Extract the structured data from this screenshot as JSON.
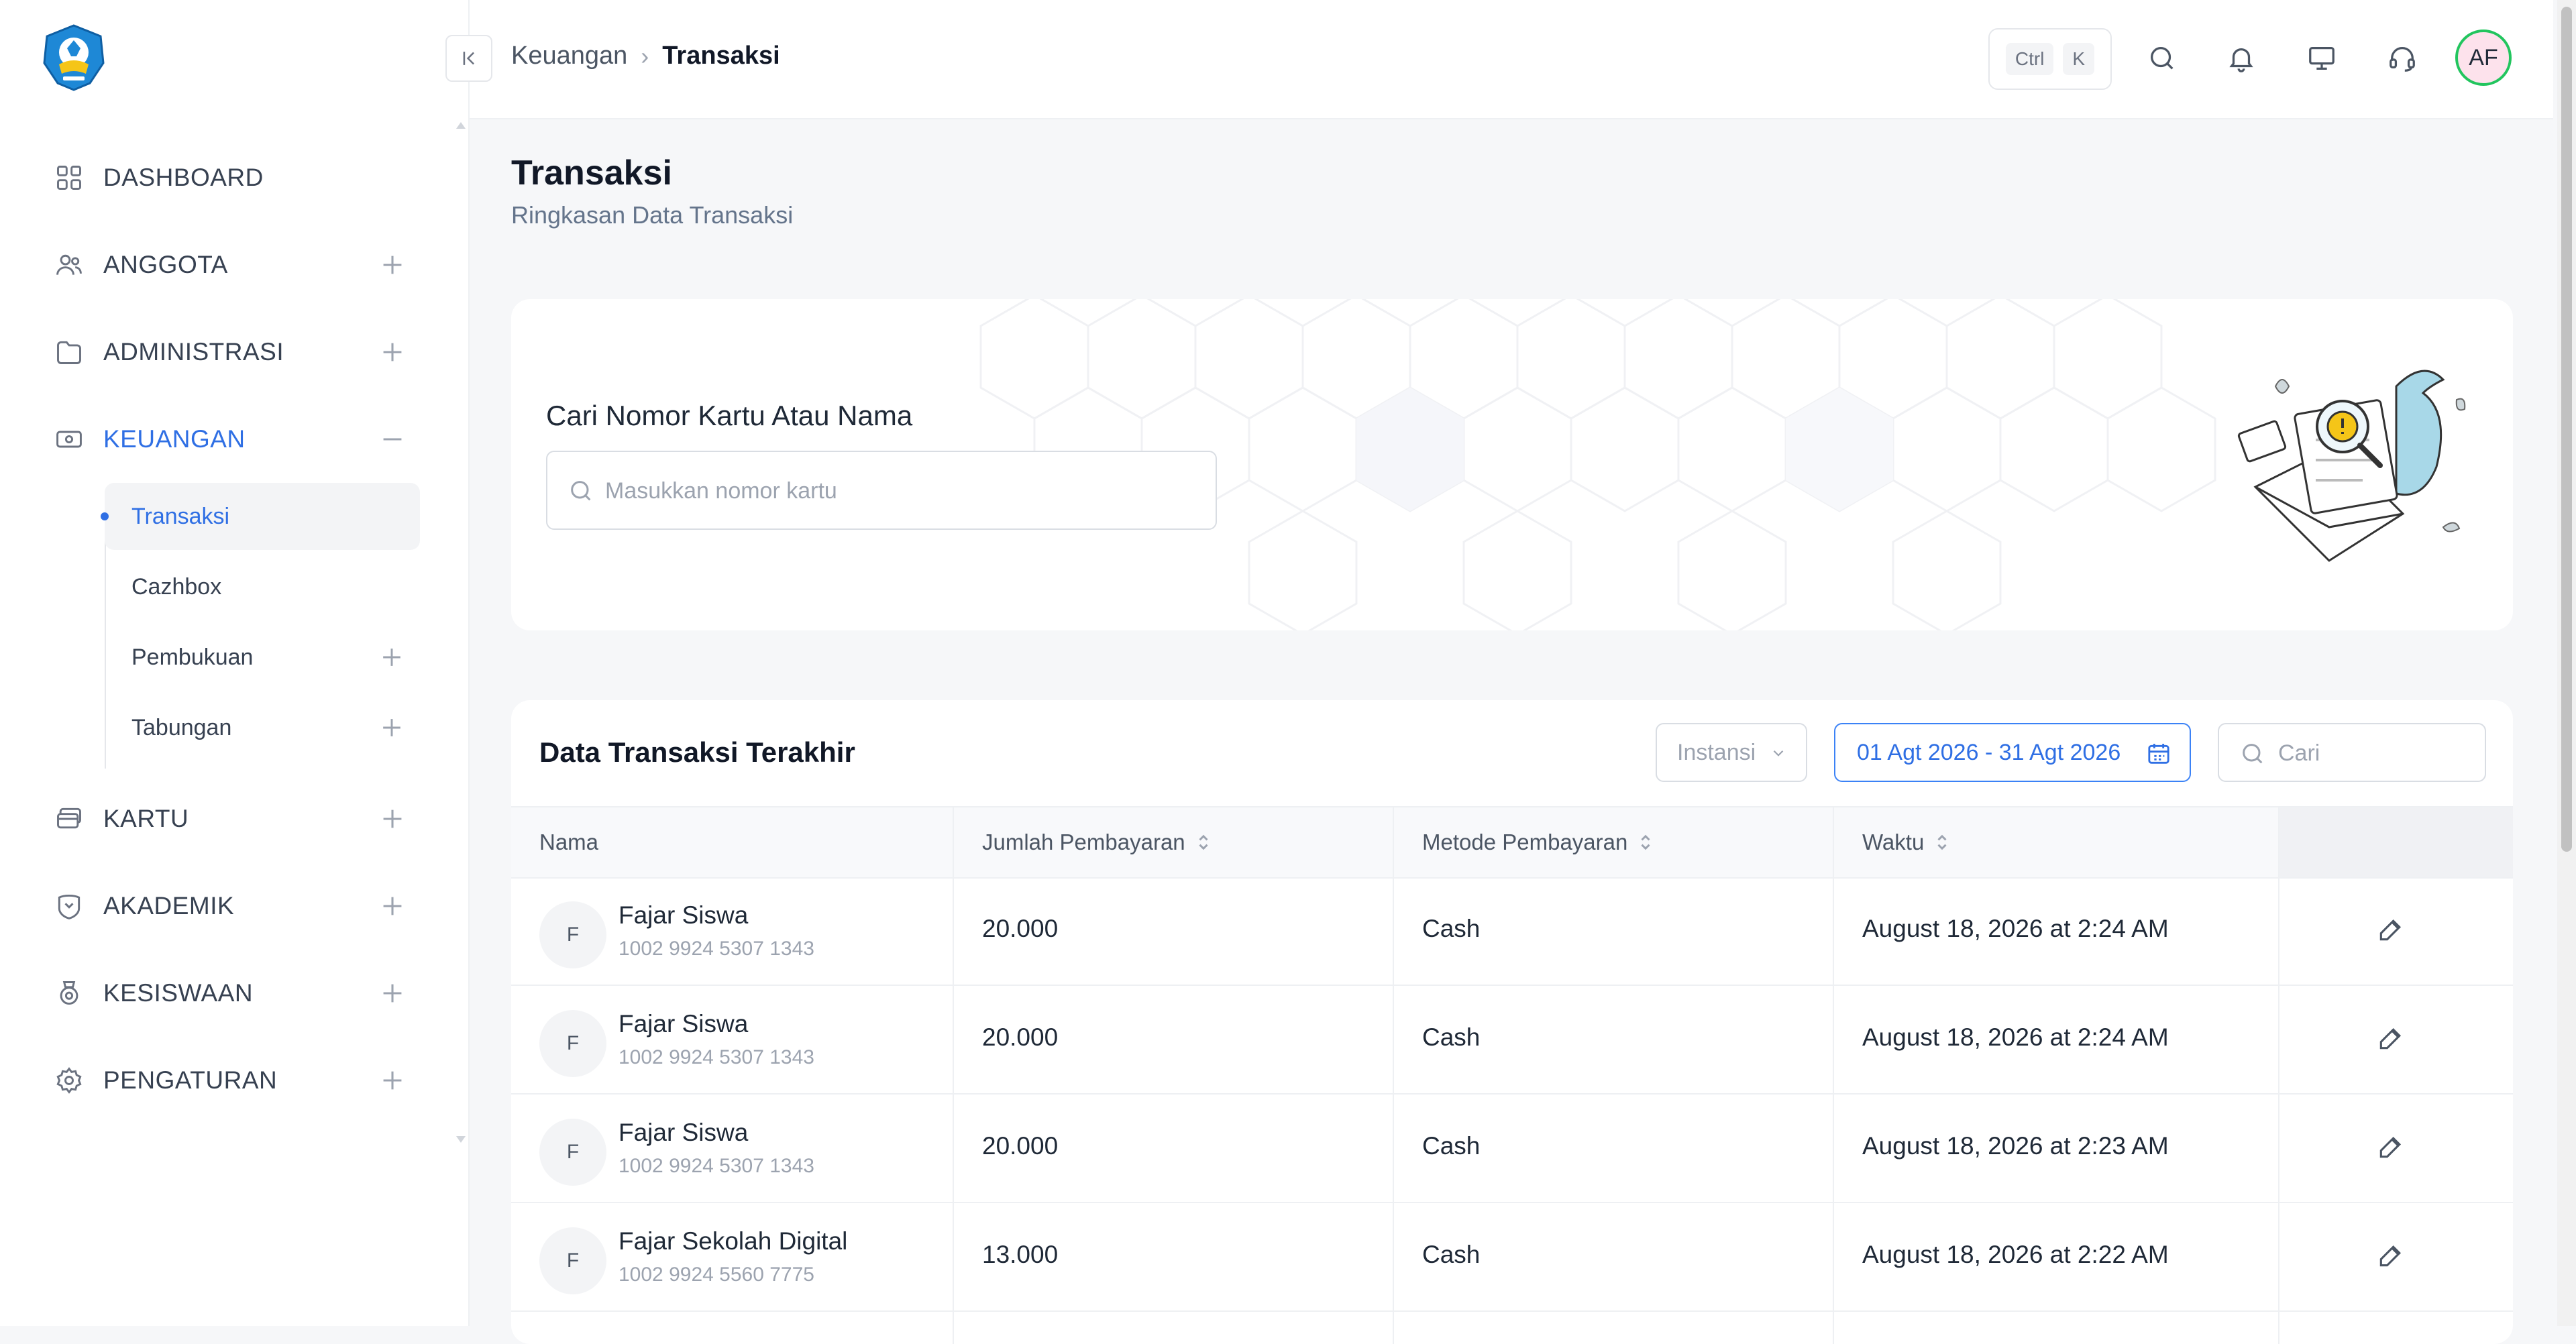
{
  "sidebar": {
    "items": [
      {
        "label": "DASHBOARD",
        "icon": "grid-icon"
      },
      {
        "label": "ANGGOTA",
        "icon": "users-icon"
      },
      {
        "label": "ADMINISTRASI",
        "icon": "folder-icon"
      },
      {
        "label": "KEUANGAN",
        "icon": "cash-icon"
      },
      {
        "label": "KARTU",
        "icon": "card-icon"
      },
      {
        "label": "AKADEMIK",
        "icon": "academic-icon"
      },
      {
        "label": "KESISWAAN",
        "icon": "badge-icon"
      },
      {
        "label": "PENGATURAN",
        "icon": "gear-icon"
      }
    ],
    "submenu": [
      "Transaksi",
      "Cazhbox",
      "Pembukuan",
      "Tabungan"
    ],
    "accent_color": "#2f6fe4"
  },
  "header": {
    "breadcrumb": [
      "Keuangan",
      "Transaksi"
    ],
    "shortcut": [
      "Ctrl",
      "K"
    ],
    "avatar_initials": "AF"
  },
  "page": {
    "title": "Transaksi",
    "subtitle": "Ringkasan Data Transaksi"
  },
  "search_card": {
    "label": "Cari Nomor Kartu Atau Nama",
    "placeholder": "Masukkan nomor kartu"
  },
  "table": {
    "title": "Data Transaksi Terakhir",
    "filter_instansi": "Instansi",
    "filter_date": "01 Agt 2026 - 31 Agt 2026",
    "search_placeholder": "Cari",
    "columns": [
      "Nama",
      "Jumlah Pembayaran",
      "Metode Pembayaran",
      "Waktu"
    ],
    "rows": [
      {
        "initial": "F",
        "name": "Fajar Siswa",
        "card": "1002 9924 5307 1343",
        "amount": "20.000",
        "method": "Cash",
        "time": "August 18, 2026 at 2:24 AM"
      },
      {
        "initial": "F",
        "name": "Fajar Siswa",
        "card": "1002 9924 5307 1343",
        "amount": "20.000",
        "method": "Cash",
        "time": "August 18, 2026 at 2:24 AM"
      },
      {
        "initial": "F",
        "name": "Fajar Siswa",
        "card": "1002 9924 5307 1343",
        "amount": "20.000",
        "method": "Cash",
        "time": "August 18, 2026 at 2:23 AM"
      },
      {
        "initial": "F",
        "name": "Fajar Sekolah Digital",
        "card": "1002 9924 5560 7775",
        "amount": "13.000",
        "method": "Cash",
        "time": "August 18, 2026 at 2:22 AM"
      }
    ]
  }
}
